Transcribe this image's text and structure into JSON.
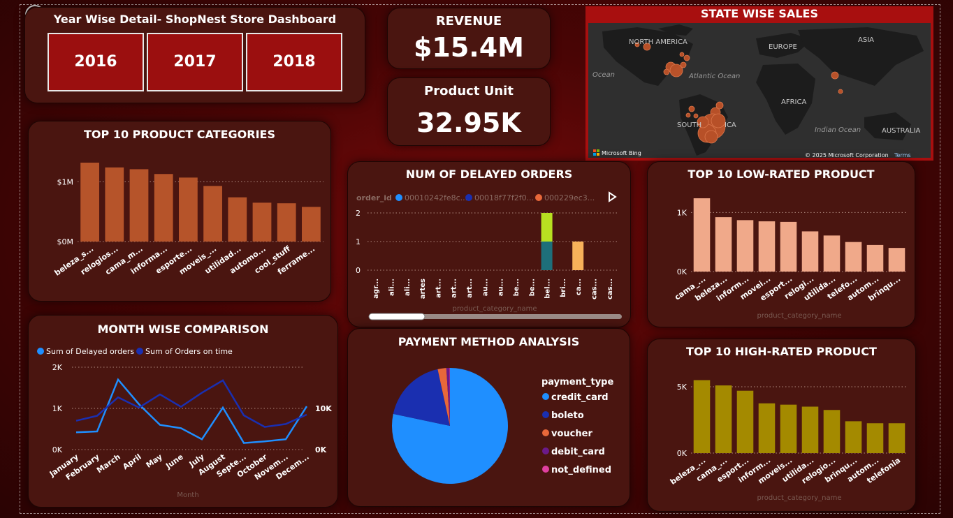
{
  "header": {
    "title": "Year Wise Detail- ShopNest Store Dashboard",
    "years": [
      "2016",
      "2017",
      "2018"
    ]
  },
  "kpis": {
    "revenue_label": "REVENUE",
    "revenue_value": "$15.4M",
    "units_label": "Product Unit",
    "units_value": "32.95K"
  },
  "map": {
    "title": "STATE WISE SALES",
    "labels": [
      "NORTH AMERICA",
      "EUROPE",
      "ASIA",
      "Ocean",
      "Atlantic Ocean",
      "AFRICA",
      "SOUTH",
      "ICA",
      "Indian Ocean",
      "AUSTRALIA"
    ],
    "brand": "Microsoft Bing",
    "copyright": "© 2025 Microsoft Corporation",
    "terms": "Terms"
  },
  "colors": {
    "categories": "#b6542a",
    "low_rated": "#f0a98a",
    "high_rated": "#a48a00",
    "delayed": "#1f8fff",
    "on_time": "#1a2fb0"
  },
  "chart_data": [
    {
      "id": "top_categories",
      "type": "bar",
      "title": "TOP 10 PRODUCT CATEGORIES",
      "categories": [
        "beleza_s...",
        "relogios...",
        "cama_m...",
        "informa...",
        "esporte...",
        "moveis_...",
        "utilidad...",
        "automo...",
        "cool_stuff",
        "ferrame..."
      ],
      "values": [
        1.32,
        1.24,
        1.21,
        1.13,
        1.07,
        0.93,
        0.74,
        0.65,
        0.64,
        0.58
      ],
      "yticks": [
        "$0M",
        "$1M"
      ],
      "ylim": [
        0,
        1.6
      ]
    },
    {
      "id": "delayed_orders",
      "type": "bar",
      "title": "NUM OF DELAYED ORDERS",
      "legend_title": "order_id",
      "legend": [
        {
          "name": "00010242fe8c...",
          "color": "#1f8fff"
        },
        {
          "name": "00018f77f2f0...",
          "color": "#1a2fb0"
        },
        {
          "name": "000229ec3...",
          "color": "#e8683a"
        }
      ],
      "categories": [
        "agr...",
        "ali...",
        "ali...",
        "artes",
        "art...",
        "art...",
        "art...",
        "au...",
        "au...",
        "be...",
        "be...",
        "bel...",
        "bri...",
        "ca...",
        "cas...",
        "cas..."
      ],
      "stacks": [
        {
          "index": 11,
          "segments": [
            {
              "value": 1,
              "color": "#1e6f7a"
            },
            {
              "value": 1,
              "color": "#b8e021"
            }
          ]
        },
        {
          "index": 13,
          "segments": [
            {
              "value": 1,
              "color": "#f7b15a"
            }
          ]
        }
      ],
      "yticks": [
        "0",
        "1",
        "2"
      ],
      "ylim": [
        0,
        2
      ],
      "xlabel": "product_category_name"
    },
    {
      "id": "low_rated",
      "type": "bar",
      "title": "TOP 10 LOW-RATED PRODUCT",
      "categories": [
        "cama_...",
        "beleza...",
        "inform...",
        "movei...",
        "esport...",
        "relogi...",
        "utilida...",
        "telefo...",
        "autom...",
        "brinqu..."
      ],
      "values": [
        1240,
        920,
        870,
        850,
        840,
        680,
        610,
        500,
        450,
        400
      ],
      "yticks": [
        "0K",
        "1K"
      ],
      "ylim": [
        0,
        1500
      ],
      "xlabel": "product_category_name"
    },
    {
      "id": "month_wise",
      "type": "line",
      "title": "MONTH WISE COMPARISON",
      "categories": [
        "January",
        "February",
        "March",
        "April",
        "May",
        "June",
        "July",
        "August",
        "Septe...",
        "October",
        "Novem...",
        "Decem..."
      ],
      "series": [
        {
          "name": "Sum of Delayed orders",
          "color": "#1f8fff",
          "values": [
            420,
            440,
            1700,
            1100,
            600,
            520,
            250,
            1020,
            160,
            200,
            250,
            1050
          ]
        },
        {
          "name": "Sum of Orders on time",
          "color": "#1a2fb0",
          "values": [
            7000,
            8200,
            12700,
            10200,
            13400,
            10400,
            13800,
            16800,
            8300,
            5500,
            6200,
            8500
          ]
        }
      ],
      "left_ticks": [
        "0K",
        "1K",
        "2K"
      ],
      "ylim_left": [
        0,
        2000
      ],
      "right_ticks": [
        "0K",
        "10K"
      ],
      "ylim_right": [
        0,
        20000
      ],
      "xlabel": "Month"
    },
    {
      "id": "payment",
      "type": "pie",
      "title": "PAYMENT METHOD ANALYSIS",
      "legend_title": "payment_type",
      "labels": [
        "credit_card",
        "boleto",
        "voucher",
        "debit_card",
        "not_defined"
      ],
      "values": [
        78.3,
        18.3,
        2.4,
        0.9,
        0.1
      ],
      "colors": [
        "#1f8fff",
        "#1a2fb0",
        "#e8683a",
        "#6b1a8a",
        "#e040a0"
      ]
    },
    {
      "id": "high_rated",
      "type": "bar",
      "title": "TOP 10 HIGH-RATED PRODUCT",
      "categories": [
        "beleza_...",
        "cama_...",
        "esport...",
        "inform...",
        "moveis...",
        "utilida...",
        "relogio...",
        "brinqu...",
        "autom...",
        "telefonia"
      ],
      "values": [
        5500,
        5100,
        4700,
        3750,
        3650,
        3500,
        3250,
        2400,
        2250,
        2250
      ],
      "yticks": [
        "0K",
        "5K"
      ],
      "ylim": [
        0,
        7000
      ],
      "xlabel": "product_category_name"
    }
  ]
}
